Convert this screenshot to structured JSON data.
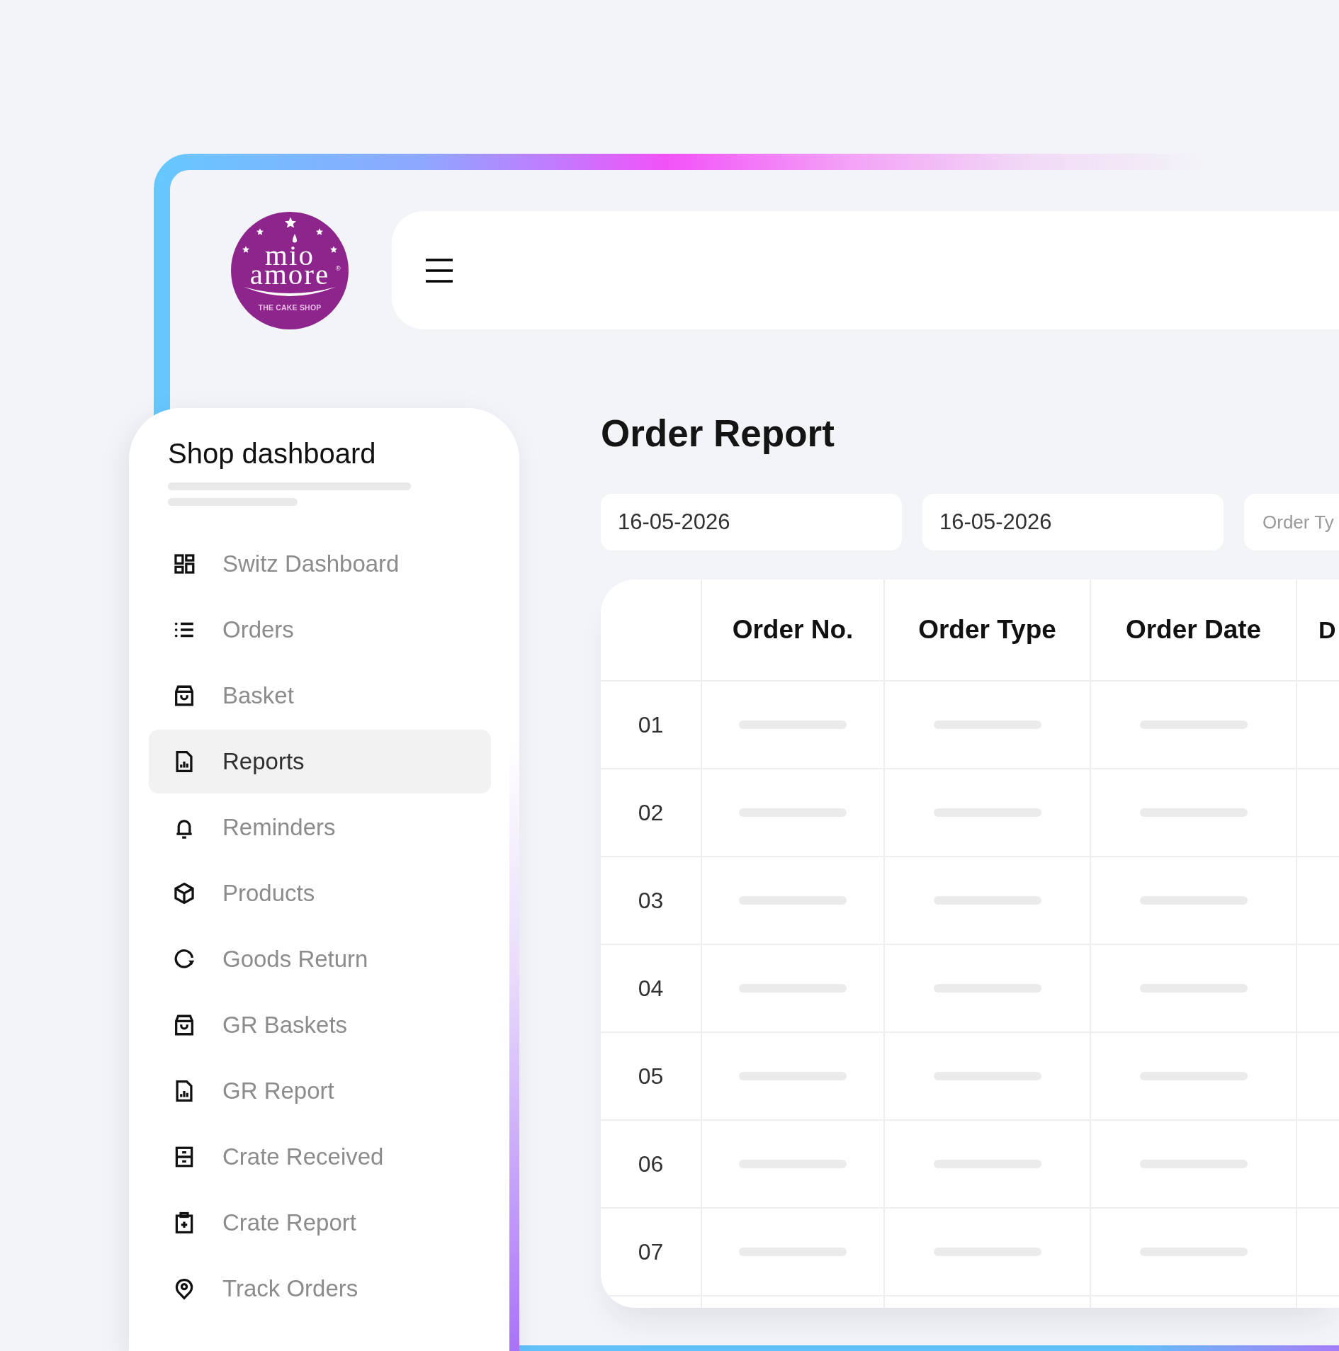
{
  "logo": {
    "wordmark": "mio amore",
    "registered_mark": "®",
    "tagline": "THE CAKE SHOP"
  },
  "sidebar": {
    "title": "Shop dashboard",
    "items": [
      {
        "label": "Switz Dashboard",
        "selected": false
      },
      {
        "label": "Orders",
        "selected": false
      },
      {
        "label": "Basket",
        "selected": false
      },
      {
        "label": "Reports",
        "selected": true
      },
      {
        "label": "Reminders",
        "selected": false
      },
      {
        "label": "Products",
        "selected": false
      },
      {
        "label": "Goods Return",
        "selected": false
      },
      {
        "label": "GR Baskets",
        "selected": false
      },
      {
        "label": "GR Report",
        "selected": false
      },
      {
        "label": "Crate Received",
        "selected": false
      },
      {
        "label": "Crate Report",
        "selected": false
      },
      {
        "label": "Track Orders",
        "selected": false
      }
    ]
  },
  "report": {
    "title": "Order Report",
    "filters": [
      {
        "kind": "date",
        "value": "16-05-2026"
      },
      {
        "kind": "date",
        "value": "16-05-2026"
      },
      {
        "kind": "text",
        "placeholder": "Order Ty"
      }
    ]
  },
  "table": {
    "columns": [
      {
        "label": "Order No.",
        "kind": "full"
      },
      {
        "label": "Order Type",
        "kind": "full"
      },
      {
        "label": "Order Date",
        "kind": "full"
      },
      {
        "label": "D",
        "kind": "cut"
      }
    ],
    "rows": [
      {
        "number": "01"
      },
      {
        "number": "02"
      },
      {
        "number": "03"
      },
      {
        "number": "04"
      },
      {
        "number": "05"
      },
      {
        "number": "06"
      },
      {
        "number": "07"
      }
    ]
  }
}
